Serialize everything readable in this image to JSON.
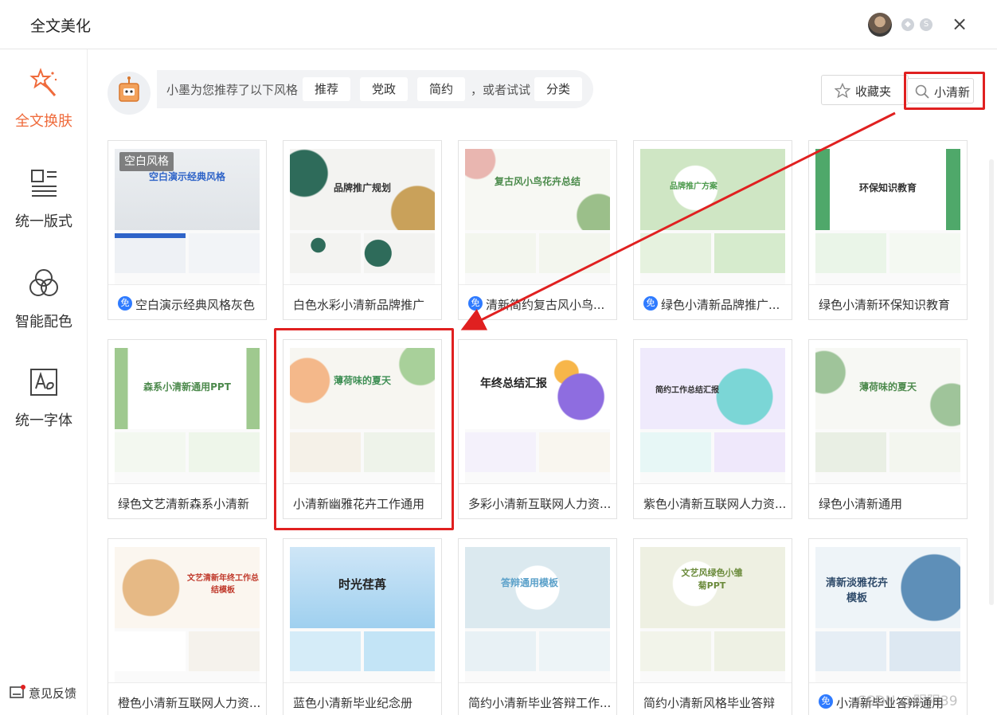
{
  "window": {
    "title": "全文美化",
    "close_glyph": "×"
  },
  "sidebar": {
    "items": [
      {
        "label": "全文换肤",
        "icon": "magic-wand-icon",
        "active": true
      },
      {
        "label": "统一版式",
        "icon": "layout-icon",
        "active": false
      },
      {
        "label": "智能配色",
        "icon": "color-circles-icon",
        "active": false
      },
      {
        "label": "统一字体",
        "icon": "font-icon",
        "active": false
      }
    ],
    "feedback_label": "意见反馈"
  },
  "recommend": {
    "message": "小墨为您推荐了以下风格",
    "chips": [
      "推荐",
      "党政",
      "简约"
    ],
    "or_try": "，或者试试",
    "category_chip": "分类"
  },
  "toolbar": {
    "favorites_label": "收藏夹",
    "search_value": "小清新"
  },
  "badge_free": "免",
  "blank_tag": "空白风格",
  "cards": [
    {
      "title": "空白演示经典风格灰色",
      "free": true,
      "thumb_text": "空白演示经典风格"
    },
    {
      "title": "白色水彩小清新品牌推广",
      "free": false,
      "thumb_text": "品牌推广规划"
    },
    {
      "title": "清新简约复古风小鸟...",
      "free": true,
      "thumb_text": "复古风小鸟花卉总结"
    },
    {
      "title": "绿色小清新品牌推广...",
      "free": true,
      "thumb_text": "品牌推广方案"
    },
    {
      "title": "绿色小清新环保知识教育",
      "free": false,
      "thumb_text": "环保知识教育"
    },
    {
      "title": "绿色文艺清新森系小清新",
      "free": false,
      "thumb_text": "森系小清新通用PPT"
    },
    {
      "title": "小清新幽雅花卉工作通用",
      "free": false,
      "thumb_text": "薄荷味的夏天"
    },
    {
      "title": "多彩小清新互联网人力资...",
      "free": false,
      "thumb_text": "年终总结汇报"
    },
    {
      "title": "紫色小清新互联网人力资...",
      "free": false,
      "thumb_text": "简约工作总结汇报"
    },
    {
      "title": "绿色小清新通用",
      "free": false,
      "thumb_text": "薄荷味的夏天"
    },
    {
      "title": "橙色小清新互联网人力资...",
      "free": false,
      "thumb_text": "文艺清新年终工作总结模板"
    },
    {
      "title": "蓝色小清新毕业纪念册",
      "free": false,
      "thumb_text": "时光荏苒"
    },
    {
      "title": "简约小清新毕业答辩工作...",
      "free": false,
      "thumb_text": "答辩通用模板"
    },
    {
      "title": "简约小清新风格毕业答辩",
      "free": false,
      "thumb_text": "文艺风绿色小雏菊PPT"
    },
    {
      "title": "小清新毕业答辩通用",
      "free": true,
      "thumb_text": "清新淡雅花卉模板"
    }
  ],
  "watermark": "CSDN @明阳39",
  "colors": {
    "accent": "#ef6b3c",
    "annotation_red": "#e02020",
    "free_badge": "#2f7bff"
  }
}
